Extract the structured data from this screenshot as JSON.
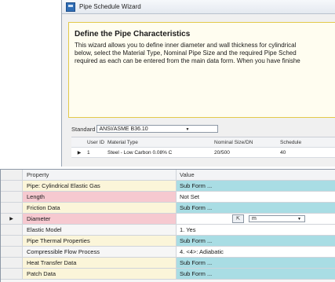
{
  "wizard": {
    "title": "Pipe Schedule Wizard",
    "heading": "Define the Pipe Characteristics",
    "description_lines": [
      "This wizard allows you to define inner diameter and wall thickness for cylindrical",
      "below, select the Material Type, Nominal Pipe Size and the required Pipe Sched",
      "required as each can be entered from the main data form. When you have finishe"
    ],
    "standard_label": "Standard",
    "standard_value": "ANSI/ASME B36.10",
    "grid": {
      "columns": [
        "User ID",
        "Material Type",
        "Nominal Size/DN",
        "Schedule"
      ],
      "rows": [
        {
          "selected": true,
          "user_id": "1",
          "material": "Steel - Low Carbon 0.08% C",
          "size": "20/500",
          "schedule": "40"
        }
      ]
    }
  },
  "property_grid": {
    "columns": [
      "Property",
      "Value"
    ],
    "rows": [
      {
        "name": "Pipe: Cylindrical Elastic Gas",
        "value": "Sub Form ...",
        "name_style": "cream",
        "value_style": "teal"
      },
      {
        "name": "Length",
        "value": "Not Set",
        "name_style": "pink",
        "value_style": "white"
      },
      {
        "name": "Friction Data",
        "value": "Sub Form ...",
        "name_style": "cream",
        "value_style": "teal"
      },
      {
        "name": "Diameter",
        "value": "",
        "name_style": "pink",
        "value_style": "white",
        "selected": true,
        "unit": "m"
      },
      {
        "name": "Elastic Model",
        "value": "1. Yes",
        "name_style": "white",
        "value_style": "white"
      },
      {
        "name": "Pipe Thermal Properties",
        "value": "Sub Form ...",
        "name_style": "cream",
        "value_style": "teal"
      },
      {
        "name": "Compressible Flow Process",
        "value": "4. <4>: Adiabatic",
        "name_style": "white",
        "value_style": "white"
      },
      {
        "name": "Heat Transfer Data",
        "value": "Sub Form ...",
        "name_style": "cream",
        "value_style": "teal"
      },
      {
        "name": "Patch Data",
        "value": "Sub Form ...",
        "name_style": "cream",
        "value_style": "teal"
      }
    ]
  }
}
